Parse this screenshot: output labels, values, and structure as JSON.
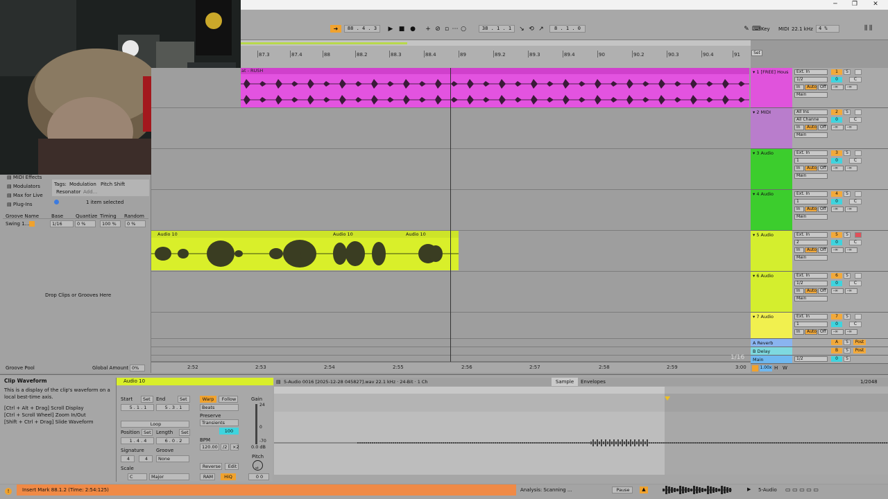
{
  "window": {
    "minimize": "─",
    "restore": "❐",
    "close": "✕"
  },
  "transport": {
    "arrangement_pos": "88 . 4 . 3",
    "loop_start": "38 . 1 . 1",
    "loop_length": "8 . 1 . 0",
    "key_label": "Key",
    "midi_label": "MIDI",
    "sample_rate": "22.1 kHz",
    "cpu": "4 %"
  },
  "ruler": {
    "bars": [
      "87.3",
      "87.4",
      "88",
      "88.2",
      "88.3",
      "88.4",
      "89",
      "89.2",
      "89.3",
      "89.4",
      "90",
      "90.2",
      "90.3",
      "90.4",
      "91"
    ],
    "set_label": "Set"
  },
  "clips": {
    "track1_clip": "at - RUSH",
    "audio_clip_labels": [
      "Audio 10",
      "Audio 10",
      "Audio 10"
    ]
  },
  "browser": {
    "categories": [
      "MIDI Effects",
      "Modulators",
      "Max for Live",
      "Plug-Ins"
    ],
    "tags_label": "Tags:",
    "tags": [
      "Modulation",
      "Pitch Shift",
      "Resonator",
      "Add..."
    ],
    "selection": "1 item selected",
    "groove_headers": [
      "Groove Name",
      "Base",
      "Quantize",
      "Timing",
      "Random"
    ],
    "groove_row": {
      "name": "Swing 1...",
      "base": "1/16",
      "quantize": "0 %",
      "timing": "100 %",
      "random": "0 %"
    },
    "drop_text": "Drop Clips or Grooves Here",
    "groove_pool": "Groove Pool",
    "global_amount_label": "Global Amount",
    "global_amount": "0%"
  },
  "tracks": [
    {
      "name": "1 [FREE] Hous",
      "num": "1",
      "input": "Ext. In",
      "channel": "1/2",
      "color": "#e452e0",
      "headcolor": "#e053dc"
    },
    {
      "name": "2 MIDI",
      "num": "2",
      "input": "All Ins",
      "channel": "All Channe",
      "color": "#b97ed0",
      "headcolor": "#b97dcc"
    },
    {
      "name": "3 Audio",
      "num": "3",
      "input": "Ext. In",
      "channel": "1",
      "color": "#3ccd2d",
      "headcolor": "#3ccd2d"
    },
    {
      "name": "4 Audio",
      "num": "4",
      "input": "Ext. In",
      "channel": "1",
      "color": "#3ccd2d",
      "headcolor": "#3ccd2d"
    },
    {
      "name": "5 Audio",
      "num": "5",
      "input": "Ext. In",
      "channel": "2",
      "color": "#ddf232",
      "headcolor": "#d4ee2e"
    },
    {
      "name": "6 Audio",
      "num": "6",
      "input": "Ext. In",
      "channel": "1/2",
      "color": "#ddf232",
      "headcolor": "#d4ee2e"
    },
    {
      "name": "7 Audio",
      "num": "7",
      "input": "Ext. In",
      "channel": "1",
      "color": "#f5f55a",
      "headcolor": "#f1f04f"
    }
  ],
  "track_common": {
    "in": "In",
    "auto": "Auto",
    "off": "Off",
    "main": "Main",
    "vol": "0",
    "pan": "C",
    "send": "-∞",
    "s": "S"
  },
  "returns": [
    {
      "name": "A Reverb",
      "letter": "A",
      "post": "Post",
      "color": "#8ab4f0"
    },
    {
      "name": "B Delay",
      "letter": "B",
      "post": "Post",
      "color": "#7ed9e0"
    },
    {
      "name": "Main",
      "letter": "0",
      "post": "",
      "color": "#6fb8f0"
    }
  ],
  "main_channel": "1/2",
  "zoom_label": "1/16",
  "time_ruler": [
    "2:52",
    "2:53",
    "2:54",
    "2:55",
    "2:56",
    "2:57",
    "2:58",
    "2:59",
    "3:00"
  ],
  "info": {
    "title": "Clip Waveform",
    "body": "This is a display of the clip's waveform on a local best-time axis.",
    "hints": [
      "[Ctrl + Alt + Drag] Scroll Display",
      "[Ctrl + Scroll Wheel] Zoom In/Out",
      "[Shift + Ctrl + Drag] Slide Waveform"
    ]
  },
  "clip": {
    "name": "Audio 10",
    "start_label": "Start",
    "end_label": "End",
    "set": "Set",
    "start": "5 . 1 . 1",
    "end": "5 . 3 . 1",
    "loop": "Loop",
    "position_label": "Position",
    "length_label": "Length",
    "position": "1 . 4 . 4",
    "length": "6 . 0 . 2",
    "signature_label": "Signature",
    "groove_label": "Groove",
    "sig_num": "4",
    "sig_den": "4",
    "groove": "None",
    "scale_label": "Scale",
    "scale_root": "C",
    "scale_mode": "Major",
    "warp": "Warp",
    "follow": "Follow",
    "beats": "Beats",
    "preserve_label": "Preserve",
    "preserve": "Transients",
    "transient_val": "100",
    "bpm_label": "BPM",
    "bpm": "120.00",
    "half": "/2",
    "double": "×2",
    "reverse": "Reverse",
    "edit": "Edit",
    "ram": "RAM",
    "hiq": "HiQ",
    "gain_label": "Gain",
    "gain_ticks": [
      "24",
      "0",
      "-70"
    ],
    "gain_value": "0.0 dB",
    "pitch_label": "Pitch",
    "pitch_unit": "st",
    "pitch_value": "0 0"
  },
  "sample": {
    "file": "5-Audio 0016 [2025-12-28 045827].wav  22.1 kHz · 24-Bit · 1 Ch",
    "tab_sample": "Sample",
    "tab_envelopes": "Envelopes",
    "grid": "1/2048"
  },
  "status": {
    "message": "Insert Mark 88.1.2 (Time: 2:54:125)",
    "analysis": "Analysis: Scanning ...",
    "pause": "Pause",
    "track_sel": "5-Audio"
  }
}
